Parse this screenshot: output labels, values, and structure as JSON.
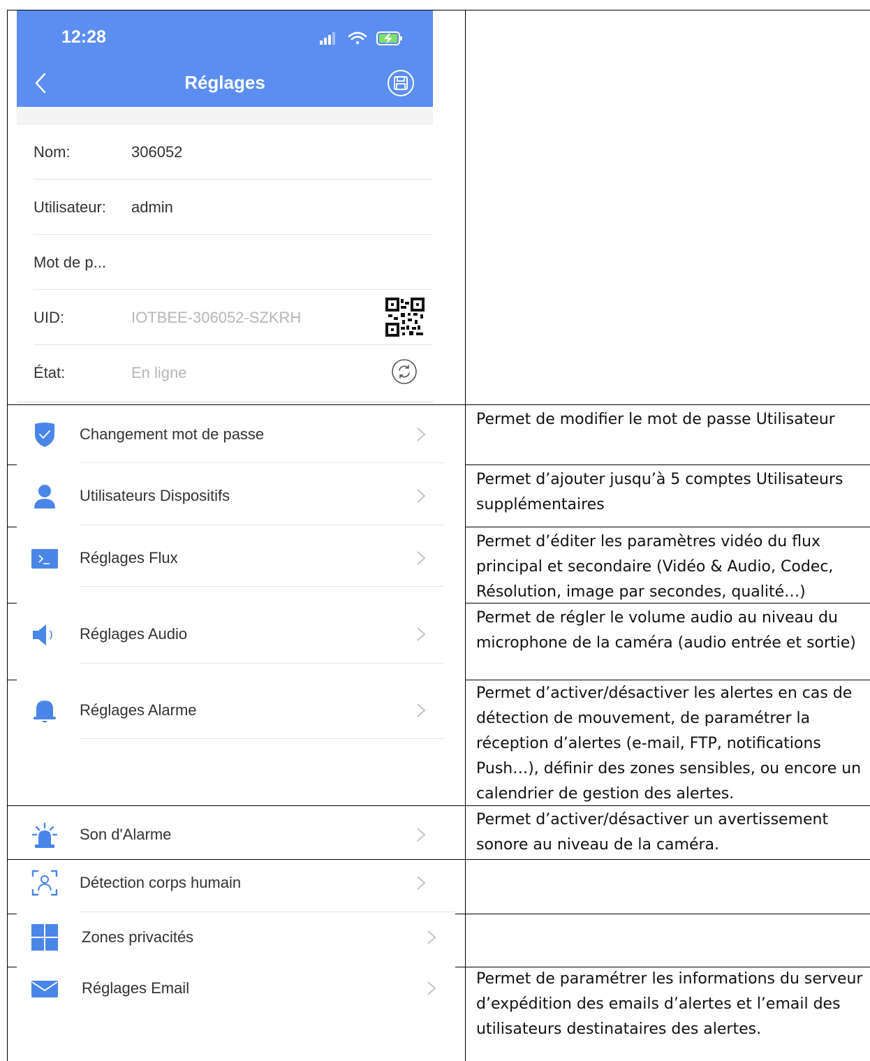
{
  "status_bar": {
    "time": "12:28"
  },
  "nav": {
    "title": "Réglages"
  },
  "info": {
    "name_label": "Nom:",
    "name_value": "306052",
    "user_label": "Utilisateur:",
    "user_value": "admin",
    "password_label": "Mot de p...",
    "uid_label": "UID:",
    "uid_value": "IOTBEE-306052-SZKRH",
    "state_label": "État:",
    "state_value": "En ligne"
  },
  "menu": [
    {
      "label": "Changement mot de passe",
      "icon": "shield-check-icon",
      "description": "Permet de modifier le mot de passe Utilisateur"
    },
    {
      "label": "Utilisateurs Dispositifs",
      "icon": "user-icon",
      "description": "Permet d’ajouter jusqu’à 5 comptes Utilisateurs supplémentaires"
    },
    {
      "label": "Réglages Flux",
      "icon": "terminal-icon",
      "description": "Permet d’éditer les paramètres vidéo du flux principal et secondaire (Vidéo & Audio, Codec, Résolution, image par secondes, qualité…)"
    },
    {
      "label": "Réglages Audio",
      "icon": "speaker-icon",
      "description": "Permet de régler le volume audio au niveau du microphone de la caméra (audio entrée et sortie)"
    },
    {
      "label": "Réglages Alarme",
      "icon": "bell-icon",
      "description": "Permet d’activer/désactiver les alertes en cas de détection de mouvement, de paramétrer la réception d’alertes (e-mail, FTP, notifications Push…), définir des zones sensibles, ou encore un calendrier de gestion des alertes."
    },
    {
      "label": "Son d'Alarme",
      "icon": "siren-icon",
      "description": "Permet d’activer/désactiver un avertissement sonore au niveau de la caméra."
    },
    {
      "label": "Détection corps humain",
      "icon": "human-detection-icon",
      "description": ""
    },
    {
      "label": "Zones privacités",
      "icon": "grid-icon",
      "description": ""
    },
    {
      "label": "Réglages Email",
      "icon": "mail-icon",
      "description": "Permet de paramétrer les informations du serveur d’expédition des emails d’alertes et l’email des utilisateurs destinataires des alertes."
    }
  ],
  "colors": {
    "header_blue": "#5b8ef0",
    "icon_blue": "#4a86e8",
    "chevron_gray": "#c4c4c4"
  }
}
